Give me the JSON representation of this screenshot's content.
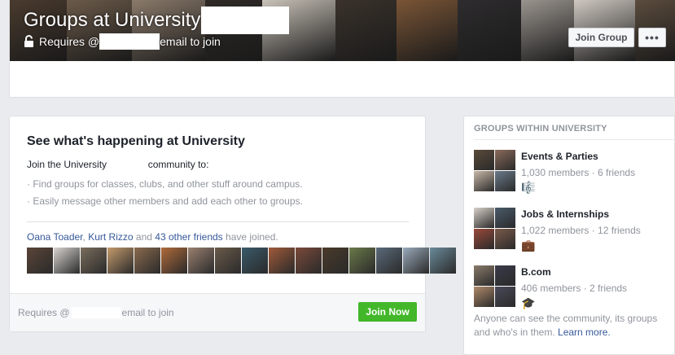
{
  "cover": {
    "title": "Groups at University",
    "subtitle_prefix": "Requires @",
    "subtitle_suffix": "email to join",
    "join_button": "Join Group",
    "more_button": "•••",
    "photo_tiles": [
      "#4a3b2e",
      "#6b5a49",
      "#8a7a6a",
      "#2f2a26",
      "#c9c2b8",
      "#3a322b",
      "#7a5536",
      "#2e2c2e",
      "#9a948e",
      "#cfc8c1",
      "#5b4c3d"
    ]
  },
  "main": {
    "heading": "See what's happening at University",
    "intro_prefix": "Join the University",
    "intro_suffix": "community to:",
    "bullets": [
      "· Find groups for classes, clubs, and other stuff around campus.",
      "· Easily message other members and add each other to groups."
    ],
    "joined": {
      "friend1": "Oana Toader",
      "sep": ",",
      "friend2": "Kurt Rizzo",
      "and": "and",
      "others": "43 other friends",
      "suffix": "have joined."
    },
    "faces": [
      "#5a4538",
      "#d8d4d0",
      "#7a6d5c",
      "#c49a6c",
      "#8a6a4e",
      "#b06a3a",
      "#9a8070",
      "#6a5a4a",
      "#3a5a6a",
      "#a05a3a",
      "#7a4a3a",
      "#4a3a2a",
      "#6a7a4a",
      "#5a6a7a",
      "#9aaabb",
      "#6a8a9a"
    ],
    "footer_prefix": "Requires @",
    "footer_suffix": "email to join",
    "join_now": "Join Now",
    "accent_green": "#42b72a",
    "link_color": "#365899"
  },
  "sidebar": {
    "title": "GROUPS WITHIN UNIVERSITY",
    "groups": [
      {
        "name": "Events & Parties",
        "meta": "1,030 members · 6 friends",
        "icon": "music-note-icon",
        "glyph": "🎼",
        "thumbs": [
          "#5a4a3a",
          "#8a6a5a",
          "#c9b8a8",
          "#6a7a8a"
        ]
      },
      {
        "name": "Jobs & Internships",
        "meta": "1,022 members · 12 friends",
        "icon": "briefcase-icon",
        "glyph": "💼",
        "thumbs": [
          "#d8d0c8",
          "#4a5a6a",
          "#9a4a3a",
          "#7a5a4a"
        ]
      },
      {
        "name": "B.com",
        "meta": "406 members · 2 friends",
        "icon": "graduation-cap-icon",
        "glyph": "🎓",
        "thumbs": [
          "#8a7a6a",
          "#3a3a4a",
          "#b08a6a",
          "#4a4a5a"
        ]
      }
    ],
    "note_text": "Anyone can see the community, its groups and who's in them.",
    "note_link": "Learn more."
  }
}
